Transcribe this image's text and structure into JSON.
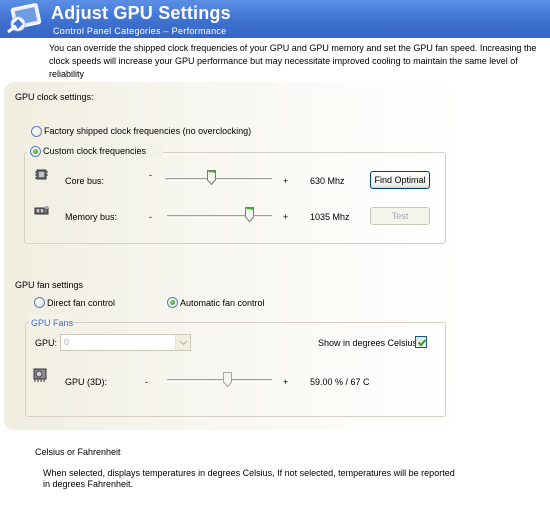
{
  "header": {
    "title": "Adjust GPU Settings",
    "subtitle": "Control Panel Categories – Performance",
    "icon": "control-panel-icon"
  },
  "description": "You can override the shipped clock frequencies of your GPU and GPU memory and set the GPU fan speed. Increasing the clock speeds will increase your GPU performance but may necessitate improved cooling to maintain the same level of reliability",
  "clock": {
    "heading": "GPU clock settings:",
    "factory_radio": {
      "label": "Factory shipped clock frequencies (no overclocking)",
      "selected": false
    },
    "custom_radio": {
      "label": "Custom clock frequencies",
      "selected": true
    },
    "core": {
      "label": "Core bus:",
      "minus": "-",
      "plus": "+",
      "value": "630 Mhz",
      "slider_fraction": 0.43,
      "button": "Find Optimal"
    },
    "memory": {
      "label": "Memory bus:",
      "minus": "-",
      "plus": "+",
      "value": "1035 Mhz",
      "slider_fraction": 0.79,
      "button": "Test"
    }
  },
  "fan": {
    "heading": "GPU fan settings",
    "direct_radio": {
      "label": "Direct fan control",
      "selected": false
    },
    "automatic_radio": {
      "label": "Automatic fan control",
      "selected": true
    },
    "group_label": "GPU Fans",
    "gpu_label": "GPU:",
    "gpu_select_value": "0",
    "show_celsius_label": "Show in degrees Celsius",
    "show_celsius_checked": true,
    "gpu3d": {
      "label": "GPU (3D):",
      "minus": "-",
      "plus": "+",
      "value": "59.00 % / 67 C",
      "slider_fraction": 0.58
    }
  },
  "help": {
    "title": "Celsius or Fahrenheit",
    "text": "When selected, displays temperatures in degrees Celsius, If not selected, temperatures will be reported in degrees Fahrenheit."
  },
  "colors": {
    "header_blue": "#3d6fcf",
    "group_label_blue": "#3a6ec9",
    "slider_thumb_green": "#3fae2f"
  }
}
